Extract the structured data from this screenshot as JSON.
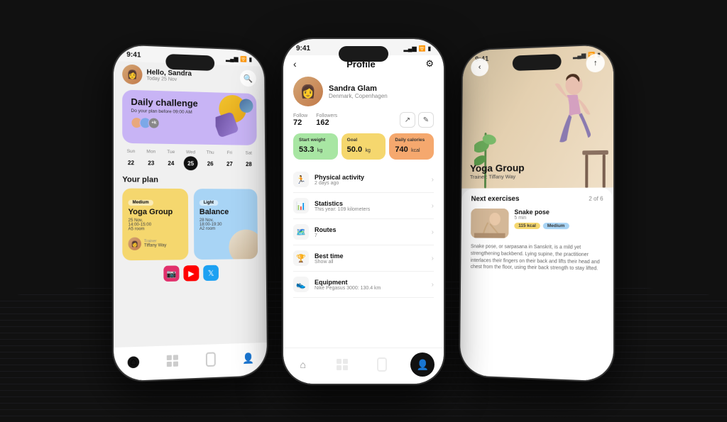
{
  "phones": {
    "left": {
      "status": {
        "time": "9:41",
        "signal": "▂▄▆",
        "wifi": "wifi",
        "battery": "🔋"
      },
      "header": {
        "greeting_hi": "Hello, Sandra",
        "date": "Today 25 Nov"
      },
      "daily_challenge": {
        "title": "Daily challenge",
        "subtitle": "Do your plan before 09:00 AM",
        "avatars_extra": "+1k"
      },
      "week": {
        "days": [
          "Sun",
          "Mon",
          "Tue",
          "Wed",
          "Thu",
          "Fri",
          "Sat"
        ],
        "dates": [
          "22",
          "23",
          "24",
          "25",
          "26",
          "27",
          "28"
        ],
        "active_index": 3
      },
      "plan": {
        "title": "Your plan",
        "cards": [
          {
            "badge": "Medium",
            "title": "Yoga Group",
            "date": "25 Nov,",
            "time": "14:00-15:00",
            "room": "A5 room",
            "trainer_label": "Trainer",
            "trainer_name": "Tiffany Way"
          },
          {
            "badge": "Light",
            "title": "Balance",
            "date": "28 Nov,",
            "time": "18:00-19:30",
            "room": "A2 room"
          }
        ]
      },
      "social_icons": [
        "instagram",
        "youtube",
        "twitter"
      ]
    },
    "center": {
      "status": {
        "time": "9:41"
      },
      "title": "Profile",
      "user": {
        "name": "Sandra Glam",
        "location": "Denmark, Copenhagen"
      },
      "follow": {
        "label": "Follow",
        "value": "72"
      },
      "followers": {
        "label": "Followers",
        "value": "162"
      },
      "metrics": [
        {
          "label": "Start weight",
          "value": "53.3",
          "unit": "kg"
        },
        {
          "label": "Goal",
          "value": "50.0",
          "unit": "kg"
        },
        {
          "label": "Daily calories",
          "value": "740",
          "unit": "kcal"
        }
      ],
      "menu_items": [
        {
          "icon": "🏃",
          "title": "Physical activity",
          "sub": "2 days ago"
        },
        {
          "icon": "📊",
          "title": "Statistics",
          "sub": "This year: 109 kilometers"
        },
        {
          "icon": "🗺️",
          "title": "Routes",
          "sub": "7"
        },
        {
          "icon": "🏆",
          "title": "Best time",
          "sub": "Show all"
        },
        {
          "icon": "👟",
          "title": "Equipment",
          "sub": "Nike Pegasus 3000: 130.4 km"
        }
      ]
    },
    "right": {
      "status": {
        "time": "9:41"
      },
      "yoga": {
        "group_title": "Yoga Group",
        "trainer": "Trainer: Tiffany Way"
      },
      "next_exercises": {
        "title": "Next exercises",
        "count": "2 of 6"
      },
      "exercise": {
        "name": "Snake pose",
        "duration": "5 min",
        "kcal": "115 kcal",
        "difficulty": "Medium",
        "description": "Snake pose, or sarpasana in Sanskrit, is a mild yet strengthening backbend. Lying supine, the practitioner interlaces their fingers on their back and lifts their head and chest from the floor, using their back strength to stay lifted."
      }
    }
  },
  "nav": {
    "home_icon": "⌂",
    "apps_icon": "⊞",
    "chart_icon": "▤",
    "person_icon": "👤"
  }
}
